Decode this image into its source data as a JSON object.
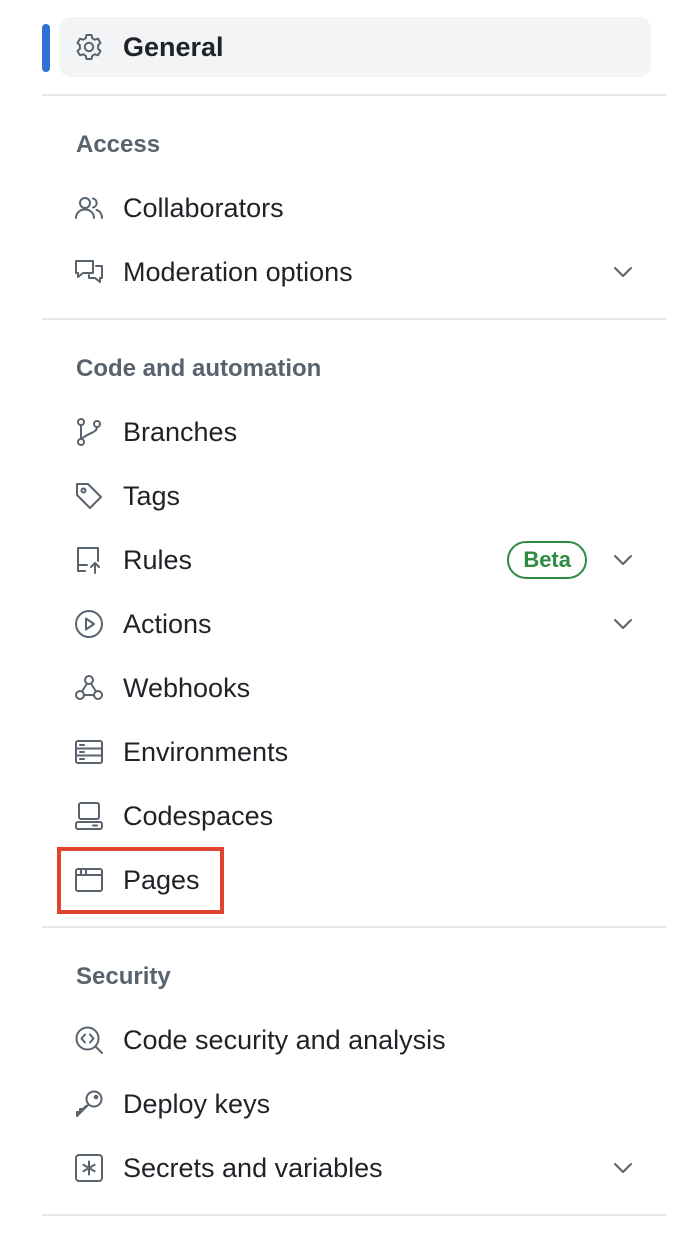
{
  "general": {
    "label": "General"
  },
  "sections": {
    "access": {
      "title": "Access",
      "collaborators": "Collaborators",
      "moderation": "Moderation options"
    },
    "code": {
      "title": "Code and automation",
      "branches": "Branches",
      "tags": "Tags",
      "rules": "Rules",
      "rules_badge": "Beta",
      "actions": "Actions",
      "webhooks": "Webhooks",
      "environments": "Environments",
      "codespaces": "Codespaces",
      "pages": "Pages"
    },
    "security": {
      "title": "Security",
      "code_security": "Code security and analysis",
      "deploy_keys": "Deploy keys",
      "secrets": "Secrets and variables"
    }
  },
  "colors": {
    "selected_indicator": "#2f6fd6",
    "highlight": "#e0442e",
    "badge": "#2f8a43"
  }
}
